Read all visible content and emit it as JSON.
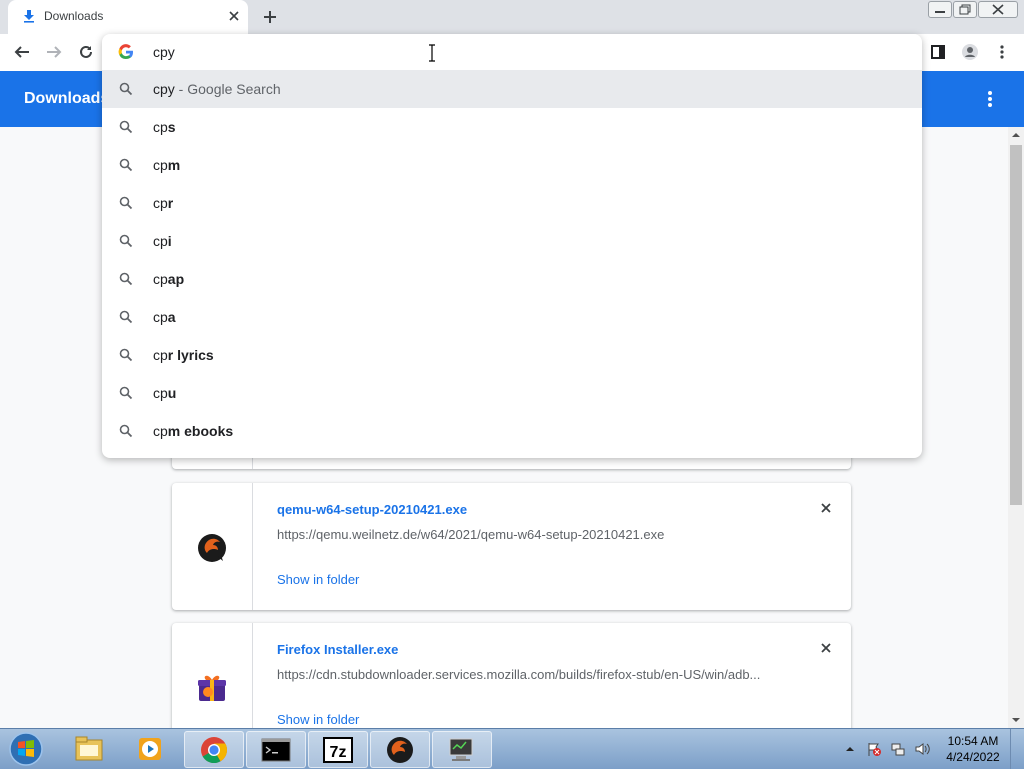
{
  "browser": {
    "tab": {
      "title": "Downloads",
      "icon": "download-icon"
    },
    "new_tab_icon": "plus-icon",
    "omnibox": {
      "value": "cpy",
      "suggestions": [
        {
          "typed": "cpy",
          "completion": "",
          "suffix": " - Google Search",
          "selected": true
        },
        {
          "typed": "cp",
          "completion": "s"
        },
        {
          "typed": "cp",
          "completion": "m"
        },
        {
          "typed": "cp",
          "completion": "r"
        },
        {
          "typed": "cp",
          "completion": "i"
        },
        {
          "typed": "cp",
          "completion": "ap"
        },
        {
          "typed": "cp",
          "completion": "a"
        },
        {
          "typed": "cp",
          "completion": "r lyrics"
        },
        {
          "typed": "cp",
          "completion": "u"
        },
        {
          "typed": "cp",
          "completion": "m ebooks"
        }
      ]
    }
  },
  "page": {
    "title": "Downloads",
    "downloads": [
      {
        "name": "qemu-w64-setup-20210421.exe",
        "url": "https://qemu.weilnetz.de/w64/2021/qemu-w64-setup-20210421.exe",
        "action": "Show in folder",
        "icon": "qemu-icon"
      },
      {
        "name": "Firefox Installer.exe",
        "url": "https://cdn.stubdownloader.services.mozilla.com/builds/firefox-stub/en-US/win/adb...",
        "action": "Show in folder",
        "icon": "gift-box-icon"
      }
    ]
  },
  "taskbar": {
    "apps": [
      "explorer-icon",
      "media-player-icon",
      "chrome-icon",
      "cmd-icon",
      "7zip-icon",
      "qemu-icon",
      "network-monitor-icon"
    ],
    "sevenzip_label": "7z",
    "clock": {
      "time": "10:54 AM",
      "date": "4/24/2022"
    }
  },
  "colors": {
    "accent": "#1a73e8",
    "link": "#1a73e8",
    "tab_strip": "#dee1e6"
  }
}
